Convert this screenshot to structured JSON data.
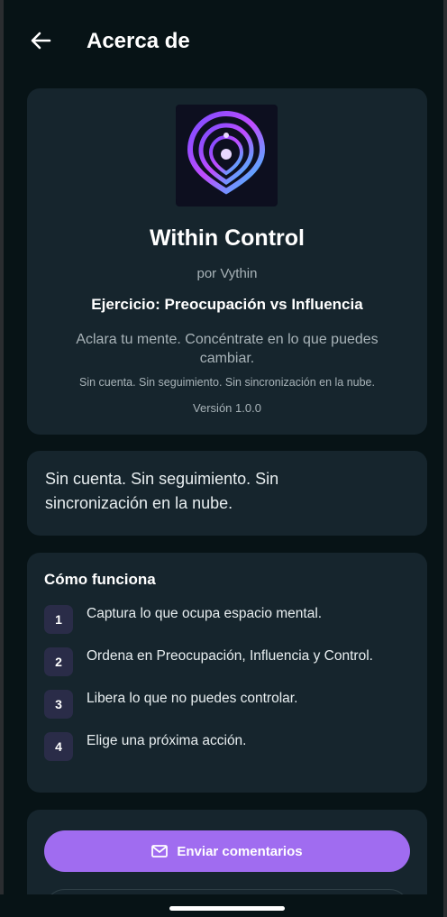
{
  "header": {
    "title": "Acerca de",
    "back_icon": "arrow-left-icon"
  },
  "about": {
    "app_icon": "within-control-logo",
    "app_name": "Within Control",
    "author": "por Vythin",
    "exercise": "Ejercicio: Preocupación vs Influencia",
    "tagline": "Aclara tu mente. Concéntrate en lo que puedes cambiar.",
    "privacy_small": "Sin cuenta. Sin seguimiento. Sin sincronización en la nube.",
    "version": "Versión 1.0.0"
  },
  "privacy": {
    "text": "Sin cuenta. Sin seguimiento. Sin sincronización en la nube."
  },
  "how_it_works": {
    "title": "Cómo funciona",
    "steps": [
      {
        "number": "1",
        "text": "Captura lo que ocupa espacio mental."
      },
      {
        "number": "2",
        "text": "Ordena en Preocupación, Influencia y Control."
      },
      {
        "number": "3",
        "text": "Libera lo que no puedes controlar."
      },
      {
        "number": "4",
        "text": "Elige una próxima acción."
      }
    ]
  },
  "actions": {
    "feedback_label": "Enviar comentarios",
    "feedback_icon": "mail-icon"
  },
  "colors": {
    "background": "#071316",
    "card": "#16252d",
    "accent": "#a06cf0",
    "step_badge": "#2a2c48"
  }
}
